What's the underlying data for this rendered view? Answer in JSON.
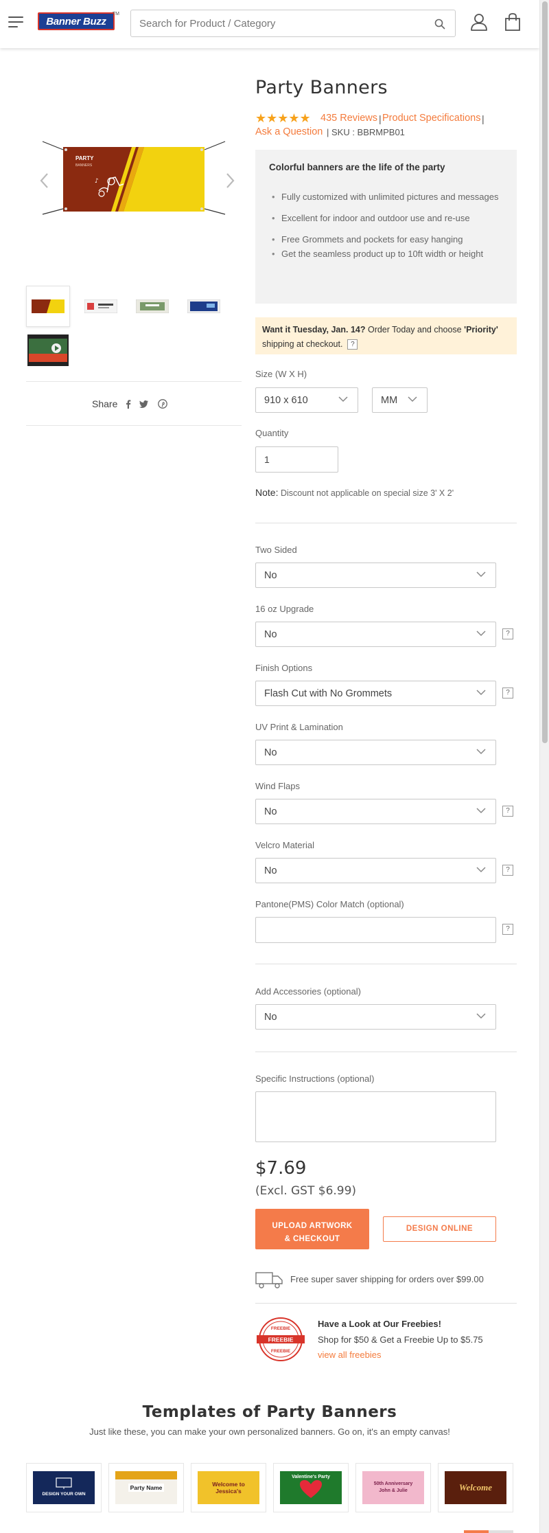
{
  "header": {
    "logo_text": "Banner Buzz",
    "logo_tm": "TM",
    "search_placeholder": "Search for Product / Category"
  },
  "gallery": {
    "banner_title": "PARTY",
    "banner_subtitle": "BANNERS",
    "share_label": "Share"
  },
  "product": {
    "title": "Party Banners",
    "stars": "★★★★★",
    "reviews": "435 Reviews",
    "specs_link": "Product Specifications",
    "ask_link": "Ask a Question",
    "sku": "| SKU : BBRMPB01",
    "sep": "|"
  },
  "features": {
    "heading": "Colorful banners are the life of the party",
    "items": [
      "Fully customized with unlimited pictures and messages",
      "Excellent for indoor and outdoor use and re-use",
      "Free Grommets and pockets for easy hanging",
      "Get the seamless product up to 10ft width or height"
    ]
  },
  "shipping_notice": {
    "bold_lead": "Want it Tuesday, Jan. 14?",
    "text_a": " Order Today and choose ",
    "bold_priority": "'Priority'",
    "text_b": " shipping at checkout.",
    "help": "?"
  },
  "size": {
    "label": "Size (W X H)",
    "value": "910 x 610",
    "unit": "MM"
  },
  "quantity": {
    "label": "Quantity",
    "value": "1"
  },
  "note": {
    "label": "Note:",
    "text": " Discount not applicable on special size 3' X 2'"
  },
  "options": [
    {
      "label": "Two Sided",
      "value": "No"
    },
    {
      "label": "16 oz Upgrade",
      "value": "No"
    },
    {
      "label": "Finish Options",
      "value": "Flash Cut with No Grommets"
    },
    {
      "label": "UV Print & Lamination",
      "value": "No"
    },
    {
      "label": "Wind Flaps",
      "value": "No"
    },
    {
      "label": "Velcro Material",
      "value": "No"
    },
    {
      "label": "Pantone(PMS) Color Match (optional)",
      "value": ""
    }
  ],
  "accessories": {
    "label": "Add Accessories (optional)",
    "value": "No"
  },
  "instructions": {
    "label": "Specific Instructions (optional)"
  },
  "help_mark": "?",
  "pricing": {
    "price": "$7.69",
    "excl": "(Excl. GST $6.99)"
  },
  "buttons": {
    "upload_line1": "UPLOAD ARTWORK",
    "upload_line2": "& CHECKOUT",
    "design": "DESIGN ONLINE"
  },
  "free_shipping": "Free super saver shipping for orders over $99.00",
  "freebie": {
    "badge_top": "FREEBIE",
    "badge_mid": "FREEBIE",
    "badge_bottom": "FREEBIE",
    "title": "Have a Look at Our Freebies!",
    "subtitle": "Shop for $50 & Get a Freebie Up to $5.75",
    "link": "view all freebies"
  },
  "templates": {
    "title": "Templates of Party Banners",
    "subtitle": "Just like these, you can make your own personalized banners. Go on, it's an empty canvas!",
    "cards": [
      {
        "line1": "DESIGN YOUR OWN",
        "line2": ""
      },
      {
        "line1": "Party Name",
        "line2": ""
      },
      {
        "line1": "Welcome to",
        "line2": "Jessica's"
      },
      {
        "line1": "Valentine's Party",
        "line2": ""
      },
      {
        "line1": "50th Anniversary",
        "line2": "John & Julie"
      },
      {
        "line1": "Welcome",
        "line2": ""
      }
    ]
  },
  "colors": {
    "accent": "#f47b4a",
    "link": "#f47b3c",
    "star": "#f7a21c",
    "banner_red": "#8b2a10",
    "banner_yellow": "#f2d20f"
  }
}
